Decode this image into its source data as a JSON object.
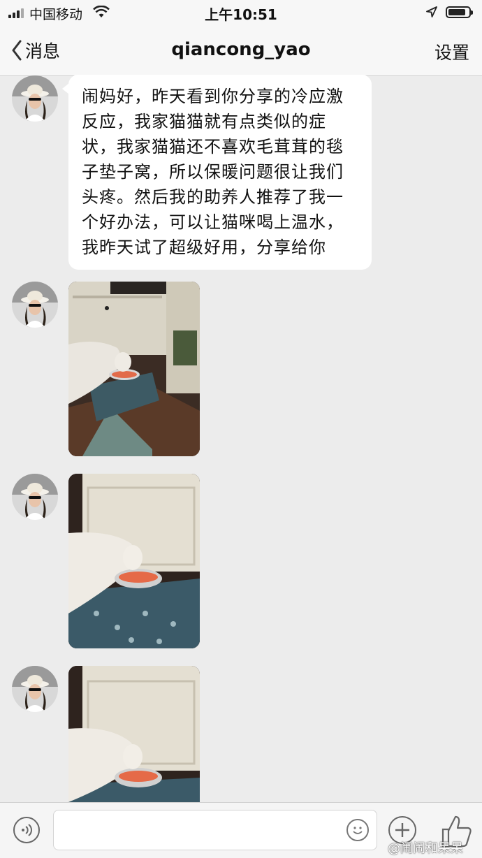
{
  "status_bar": {
    "carrier": "中国移动",
    "time": "上午10:51"
  },
  "nav": {
    "back_label": "消息",
    "title": "qiancong_yao",
    "settings_label": "设置"
  },
  "messages": [
    {
      "type": "text",
      "text": "闹妈好，昨天看到你分享的冷应激反应，我家猫猫就有点类似的症状，我家猫猫还不喜欢毛茸茸的毯子垫子窝，所以保暖问题很让我们头疼。然后我的助养人推荐了我一个好办法，可以让猫咪喝上温水，我昨天试了超级好用，分享给你"
    },
    {
      "type": "image",
      "icon": "cat-drinking-photo"
    },
    {
      "type": "image",
      "icon": "cat-drinking-photo"
    },
    {
      "type": "image",
      "icon": "cat-drinking-photo"
    }
  ],
  "input_bar": {
    "placeholder": "",
    "value": ""
  },
  "watermark": "@闹闹和呆呆"
}
